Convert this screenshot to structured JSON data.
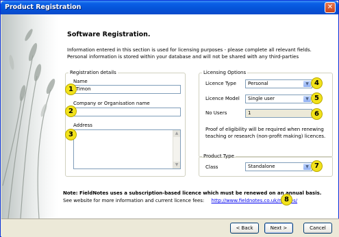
{
  "window": {
    "title": "Product Registration",
    "close_glyph": "✕"
  },
  "page": {
    "heading": "Software Registration.",
    "intro_line1": "Information entered in this section is used for licensing purposes - please complete all relevant fields.",
    "intro_line2": "Personal information is stored within your database and will not be shared with any third-parties"
  },
  "registration": {
    "legend": "Registration details",
    "name_label": "Name",
    "name_value": "Timon",
    "company_label": "Company or Organisation name",
    "company_value": "",
    "address_label": "Address",
    "address_value": ""
  },
  "licensing": {
    "legend": "Licensing Options",
    "type_label": "Licence Type",
    "type_value": "Personal",
    "model_label": "Licence Model",
    "model_value": "Single user",
    "users_label": "No Users",
    "users_value": "1",
    "proof_line1": "Proof of eligibility will be required when renewing",
    "proof_line2": "teaching or research (non-profit making) licences."
  },
  "product_type": {
    "legend": "Product Type",
    "class_label": "Class",
    "class_value": "Standalone"
  },
  "footer_note": {
    "note": "Note: FieldNotes uses a subscription-based licence which must be renewed on an annual basis.",
    "see_text": "See website for more information and current licence fees:",
    "link_text": "http://www.fieldnotes.co.uk/notices/"
  },
  "badges": [
    "1",
    "2",
    "3",
    "4",
    "5",
    "6",
    "7",
    "8"
  ],
  "buttons": {
    "back": "< Back",
    "next": "Next >",
    "cancel": "Cancel"
  },
  "colors": {
    "title_bar": "#0553d8",
    "badge": "#f2e21b",
    "link": "#0000ee"
  },
  "icons": {
    "close": "close-icon",
    "dropdown": "chevron-down-icon",
    "scroll_up": "scroll-up-icon",
    "scroll_down": "scroll-down-icon"
  }
}
